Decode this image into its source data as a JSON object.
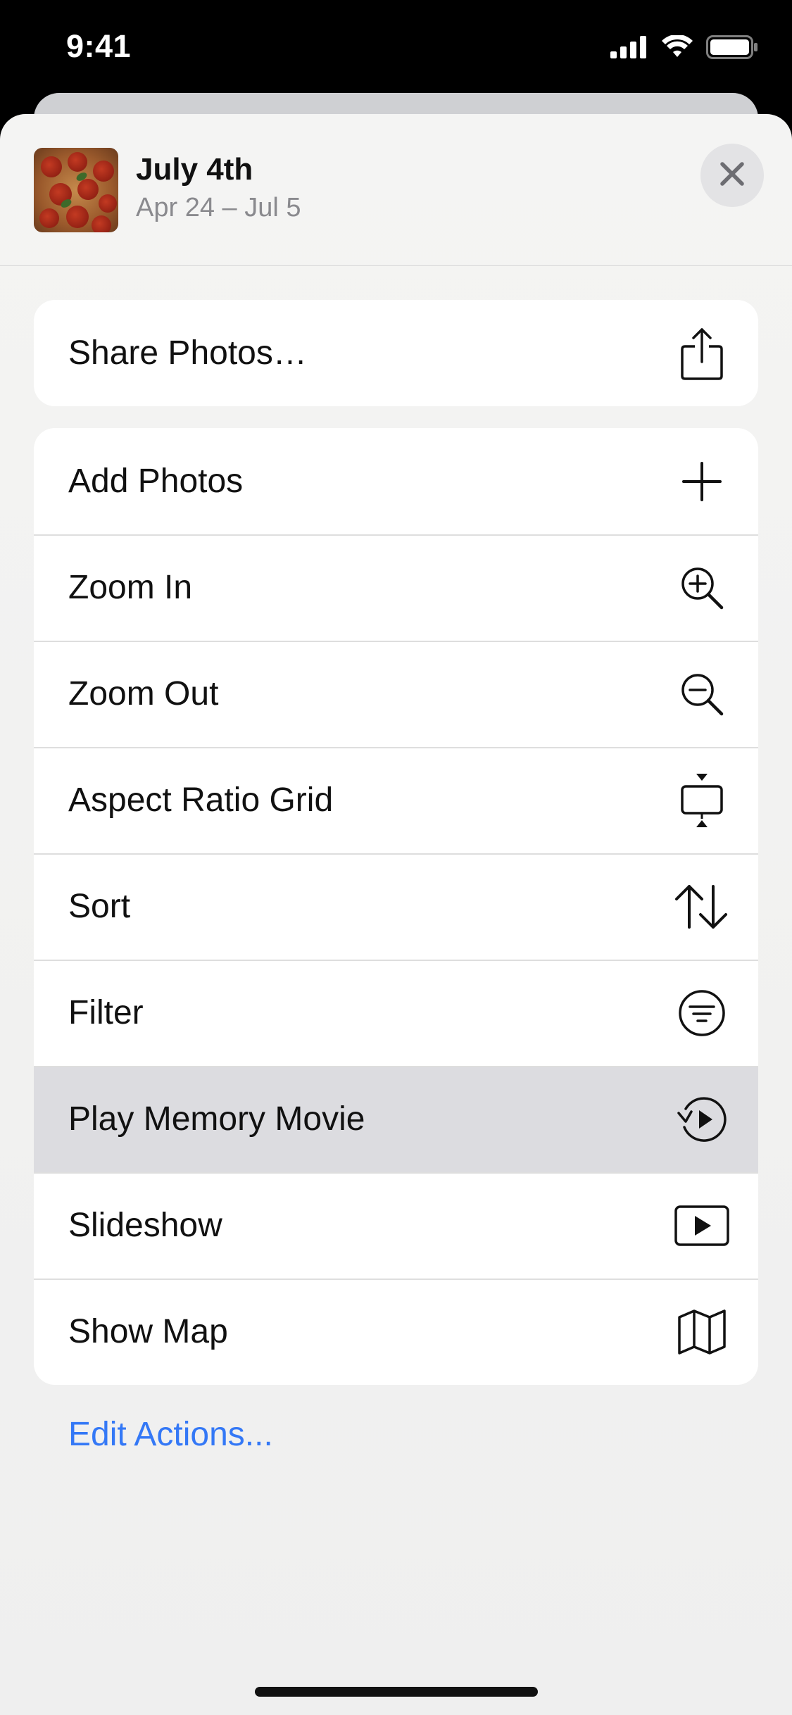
{
  "status_bar": {
    "time": "9:41",
    "icons": [
      "cellular-signal-icon",
      "wifi-icon",
      "battery-icon"
    ]
  },
  "header": {
    "title": "July 4th",
    "subtitle": "Apr 24 – Jul 5",
    "thumbnail": "pizza-photo",
    "close_icon": "close-icon"
  },
  "share_group": {
    "items": [
      {
        "label": "Share Photos…",
        "icon": "share-icon"
      }
    ]
  },
  "menu": {
    "items": [
      {
        "label": "Add Photos",
        "icon": "plus-icon"
      },
      {
        "label": "Zoom In",
        "icon": "zoom-in-icon"
      },
      {
        "label": "Zoom Out",
        "icon": "zoom-out-icon"
      },
      {
        "label": "Aspect Ratio Grid",
        "icon": "aspect-ratio-icon"
      },
      {
        "label": "Sort",
        "icon": "sort-arrows-icon"
      },
      {
        "label": "Filter",
        "icon": "filter-icon"
      },
      {
        "label": "Play Memory Movie",
        "icon": "memory-movie-icon",
        "highlighted": true
      },
      {
        "label": "Slideshow",
        "icon": "slideshow-icon"
      },
      {
        "label": "Show Map",
        "icon": "map-icon"
      }
    ]
  },
  "footer": {
    "edit_actions": "Edit Actions..."
  },
  "colors": {
    "accent": "#3478f6",
    "highlight_row": "#dcdce0",
    "sheet_background": "#f2f2f1"
  }
}
